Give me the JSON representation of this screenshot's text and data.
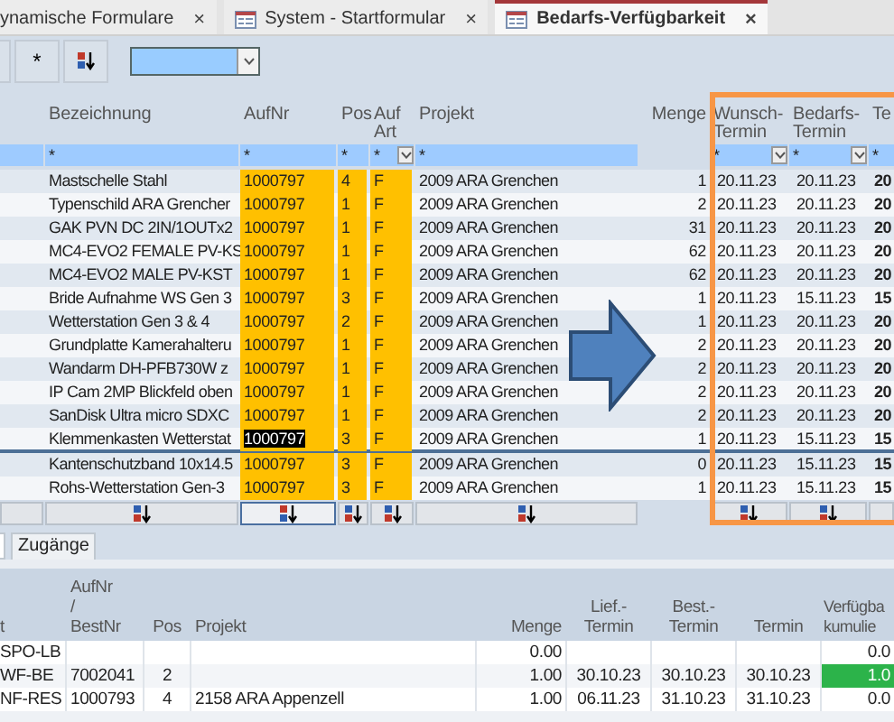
{
  "doc_tabs": [
    {
      "label": "ynamische Formulare",
      "close": "×",
      "selected": false,
      "icon": false
    },
    {
      "label": "System - Startformular",
      "close": "×",
      "selected": false,
      "icon": true
    },
    {
      "label": "Bedarfs-Verfügbarkeit",
      "close": "×",
      "selected": true,
      "icon": true
    }
  ],
  "toolbar": {
    "buttons": [
      {
        "kind": "blank"
      },
      {
        "kind": "text",
        "label": "*"
      },
      {
        "kind": "sort"
      }
    ]
  },
  "top_grid": {
    "columns": [
      {
        "kind": "selector",
        "sort_button": true,
        "sort_icon": false,
        "sort_focused": false
      },
      {
        "kind": "text",
        "header": "Bezeichnung",
        "filter": "*",
        "dropdown": false,
        "sort_button": true,
        "sort_icon": true,
        "sort_descending": false,
        "sort_focused": false
      },
      {
        "kind": "code",
        "header": "AufNr",
        "filter": "*",
        "dropdown": false,
        "sort_button": true,
        "sort_icon": true,
        "sort_descending": true,
        "sort_focused": true
      },
      {
        "kind": "code",
        "header": "Pos",
        "filter": "*",
        "dropdown": false,
        "sort_button": true,
        "sort_icon": true,
        "sort_descending": false,
        "sort_focused": false
      },
      {
        "kind": "code",
        "header": "Auf\nArt",
        "filter": "*",
        "dropdown": true,
        "sort_button": true,
        "sort_icon": true,
        "sort_descending": false,
        "sort_focused": false
      },
      {
        "kind": "text",
        "header": "Projekt",
        "filter": "*",
        "dropdown": false,
        "sort_button": true,
        "sort_icon": true,
        "sort_descending": false,
        "sort_focused": false
      },
      {
        "kind": "number",
        "header": "Menge",
        "sort_button": false
      },
      {
        "kind": "date",
        "header": "Wunsch-\nTermin",
        "filter": "*",
        "dropdown": true,
        "sort_button": true,
        "sort_icon": true,
        "sort_descending": false,
        "sort_focused": false
      },
      {
        "kind": "date",
        "header": "Bedarfs-\nTermin",
        "filter": "*",
        "dropdown": true,
        "sort_button": true,
        "sort_icon": true,
        "sort_descending": false,
        "sort_focused": false
      },
      {
        "kind": "bolddate",
        "header": "Te",
        "filter": "*",
        "dropdown": false,
        "sort_button": true,
        "sort_icon": false,
        "sort_focused": false
      }
    ],
    "rows": [
      {
        "selected": false,
        "cells": [
          "",
          "Mastschelle Stahl",
          "1000797",
          "4",
          "F",
          "2009 ARA Grenchen",
          "1",
          "20.11.23",
          "20.11.23",
          "20"
        ]
      },
      {
        "selected": false,
        "cells": [
          "",
          "Typenschild ARA Grencher",
          "1000797",
          "1",
          "F",
          "2009 ARA Grenchen",
          "2",
          "20.11.23",
          "20.11.23",
          "20"
        ]
      },
      {
        "selected": false,
        "cells": [
          "",
          "GAK PVN DC 2IN/1OUTx2",
          "1000797",
          "1",
          "F",
          "2009 ARA Grenchen",
          "31",
          "20.11.23",
          "20.11.23",
          "20"
        ]
      },
      {
        "selected": false,
        "cells": [
          "",
          "MC4-EVO2 FEMALE PV-KS",
          "1000797",
          "1",
          "F",
          "2009 ARA Grenchen",
          "62",
          "20.11.23",
          "20.11.23",
          "20"
        ]
      },
      {
        "selected": false,
        "cells": [
          "",
          "MC4-EVO2 MALE PV-KST",
          "1000797",
          "1",
          "F",
          "2009 ARA Grenchen",
          "62",
          "20.11.23",
          "20.11.23",
          "20"
        ]
      },
      {
        "selected": false,
        "cells": [
          "",
          "Bride Aufnahme WS Gen 3",
          "1000797",
          "3",
          "F",
          "2009 ARA Grenchen",
          "1",
          "20.11.23",
          "15.11.23",
          "15"
        ]
      },
      {
        "selected": false,
        "cells": [
          "",
          "Wetterstation Gen 3 & 4",
          "1000797",
          "2",
          "F",
          "2009 ARA Grenchen",
          "1",
          "20.11.23",
          "20.11.23",
          "20"
        ]
      },
      {
        "selected": false,
        "cells": [
          "",
          "Grundplatte Kamerahalteru",
          "1000797",
          "1",
          "F",
          "2009 ARA Grenchen",
          "2",
          "20.11.23",
          "20.11.23",
          "20"
        ]
      },
      {
        "selected": false,
        "cells": [
          "",
          "Wandarm DH-PFB730W z",
          "1000797",
          "1",
          "F",
          "2009 ARA Grenchen",
          "2",
          "20.11.23",
          "20.11.23",
          "20"
        ]
      },
      {
        "selected": false,
        "cells": [
          "",
          "IP Cam 2MP Blickfeld oben",
          "1000797",
          "1",
          "F",
          "2009 ARA Grenchen",
          "2",
          "20.11.23",
          "20.11.23",
          "20"
        ]
      },
      {
        "selected": false,
        "cells": [
          "",
          "SanDisk Ultra micro SDXC",
          "1000797",
          "1",
          "F",
          "2009 ARA Grenchen",
          "2",
          "20.11.23",
          "20.11.23",
          "20"
        ]
      },
      {
        "selected": true,
        "cells": [
          "",
          "Klemmenkasten Wetterstat",
          "1000797",
          "3",
          "F",
          "2009 ARA Grenchen",
          "1",
          "20.11.23",
          "15.11.23",
          "15"
        ]
      },
      {
        "selected": false,
        "cells": [
          "",
          "Kantenschutzband 10x14.5",
          "1000797",
          "3",
          "F",
          "2009 ARA Grenchen",
          "0",
          "20.11.23",
          "15.11.23",
          "15"
        ]
      },
      {
        "selected": false,
        "cells": [
          "",
          "Rohs-Wetterstation Gen-3",
          "1000797",
          "3",
          "F",
          "2009 ARA Grenchen",
          "1",
          "20.11.23",
          "15.11.23",
          "15"
        ]
      }
    ]
  },
  "sub_tabs": [
    {
      "label": "Zugänge",
      "selected": false
    }
  ],
  "bottom_grid": {
    "columns": [
      {
        "kind": "text",
        "header": "t"
      },
      {
        "kind": "text",
        "header": "AufNr\n/\nBestNr"
      },
      {
        "kind": "center",
        "header": "Pos"
      },
      {
        "kind": "text",
        "header": "Projekt"
      },
      {
        "kind": "number",
        "header": "Menge"
      },
      {
        "kind": "center",
        "header": "Lief.-\nTermin"
      },
      {
        "kind": "center",
        "header": "Best.-\nTermin"
      },
      {
        "kind": "center",
        "header": "Termin"
      },
      {
        "kind": "number",
        "header": "Verfügba\nkumulie"
      }
    ],
    "rows": [
      {
        "highlight": false,
        "cells": [
          "SPO-LB",
          "",
          "",
          "",
          "0.00",
          "",
          "",
          "",
          "0.0"
        ]
      },
      {
        "highlight": true,
        "cells": [
          "WF-BE",
          "7002041",
          "2",
          "",
          "1.00",
          "30.10.23",
          "30.10.23",
          "30.10.23",
          "1.0"
        ]
      },
      {
        "highlight": false,
        "cells": [
          "NF-RES",
          "1000793",
          "4",
          "2158 ARA Appenzell",
          "1.00",
          "06.11.23",
          "31.10.23",
          "31.10.23",
          "0.0"
        ]
      }
    ]
  }
}
